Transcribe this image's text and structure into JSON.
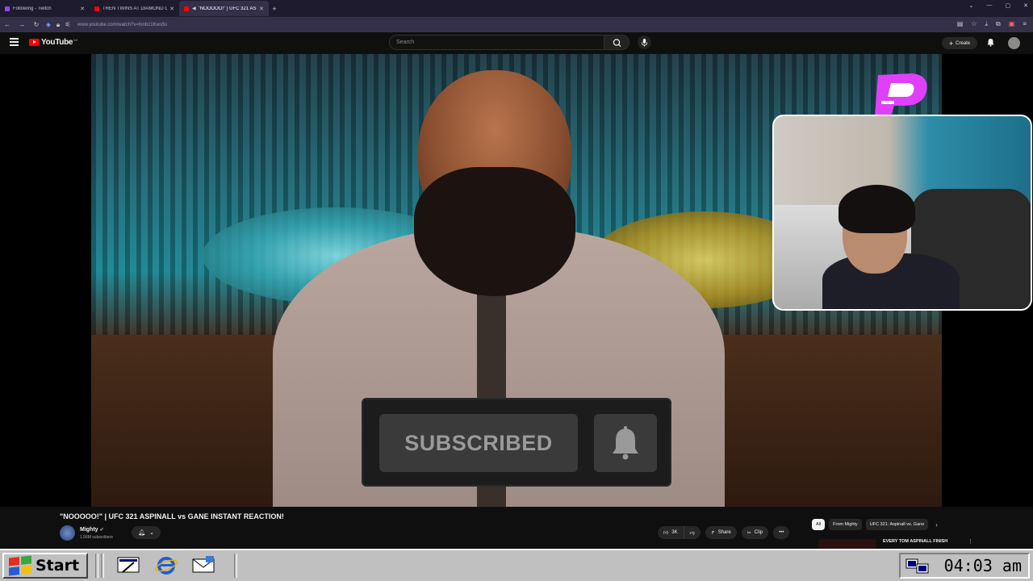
{
  "browser": {
    "tabs": [
      {
        "title": "Following - Twitch",
        "favicon_color": "#9146ff",
        "active": false
      },
      {
        "title": "TREN TWINS AT DIAMOND GYM",
        "favicon_color": "#ff0000",
        "active": false
      },
      {
        "title": "\"NOOOOO!\" | UFC 321 ASPI",
        "favicon_color": "#ff0000",
        "active": true
      }
    ],
    "url": "www.youtube.com/watch?v=fxnbz1Kws5s"
  },
  "youtube": {
    "logo_text": "YouTube",
    "country_code": "KZ",
    "search_placeholder": "Search",
    "create_label": "Create"
  },
  "overlay": {
    "subscribed_label": "SUBSCRIBED"
  },
  "video": {
    "title": "\"NOOOOO!\" | UFC 321 ASPINALL vs GANE INSTANT REACTION!",
    "channel_name": "Mighty",
    "subscribers": "1.56M subscribers",
    "likes": "3K",
    "share_label": "Share",
    "clip_label": "Clip"
  },
  "sidebar": {
    "chips": [
      "All",
      "From Mighty",
      "UFC 321: Aspinall vs. Gane"
    ],
    "selected_chip": "All",
    "next_video_title": "EVERY TOM ASPINALL FINISH"
  },
  "taskbar": {
    "start_label": "Start",
    "clock": "04:03 am"
  },
  "colors": {
    "youtube_red": "#ff0000",
    "page_bg": "#0f0f0f",
    "taskbar_gray": "#c0c0c0"
  }
}
